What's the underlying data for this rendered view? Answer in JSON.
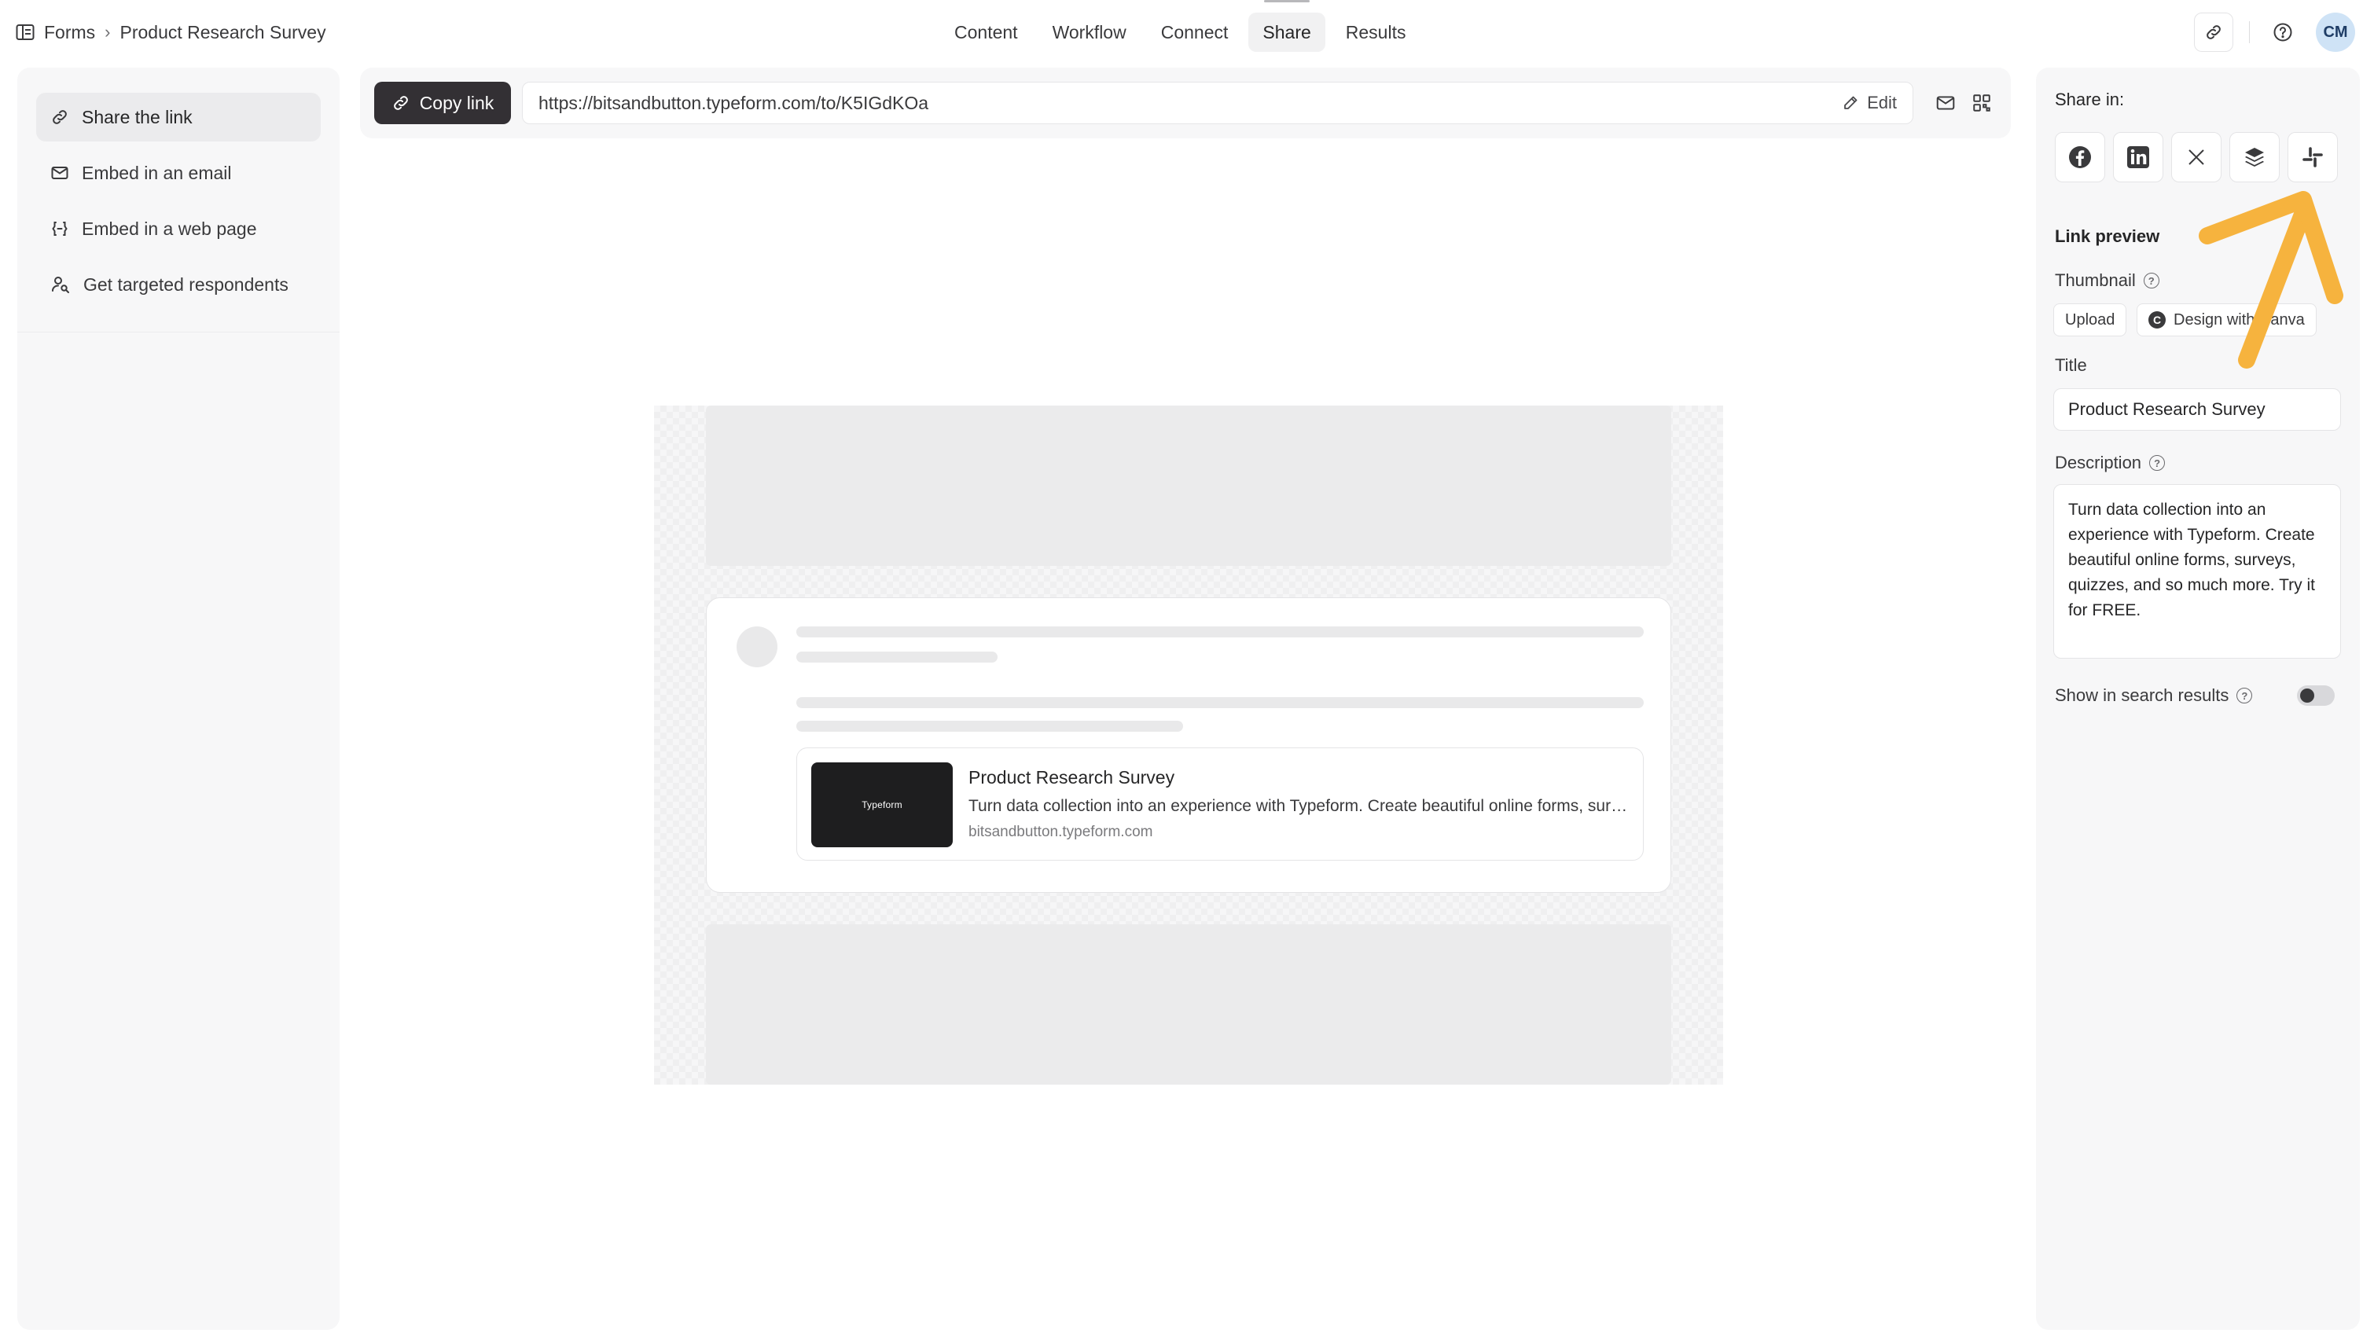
{
  "breadcrumb": {
    "root": "Forms",
    "current": "Product Research Survey"
  },
  "nav": {
    "tabs": [
      {
        "label": "Content"
      },
      {
        "label": "Workflow"
      },
      {
        "label": "Connect"
      },
      {
        "label": "Share",
        "active": true
      },
      {
        "label": "Results"
      }
    ]
  },
  "user": {
    "initials": "CM"
  },
  "sidebar": {
    "items": [
      {
        "label": "Share the link",
        "icon": "link-icon",
        "active": true
      },
      {
        "label": "Embed in an email",
        "icon": "mail-icon"
      },
      {
        "label": "Embed in a web page",
        "icon": "embed-code-icon"
      },
      {
        "label": "Get targeted respondents",
        "icon": "people-search-icon"
      }
    ]
  },
  "linkbar": {
    "copy_label": "Copy link",
    "url": "https://bitsandbutton.typeform.com/to/K5IGdKOa",
    "edit_label": "Edit"
  },
  "preview": {
    "thumb_brand": "Typeform",
    "title": "Product Research Survey",
    "description": "Turn data collection into an experience with Typeform. Create beautiful online forms, surveys, quizzes, and so much more. Try it for FREE.",
    "domain": "bitsandbutton.typeform.com"
  },
  "right_panel": {
    "share_in_label": "Share in:",
    "share_icons": [
      "facebook-icon",
      "linkedin-icon",
      "x-icon",
      "buffer-icon",
      "slack-icon"
    ],
    "link_preview_heading": "Link preview",
    "thumbnail_label": "Thumbnail",
    "upload_label": "Upload",
    "canva_label": "Design with Canva",
    "canva_glyph": "C",
    "title_label": "Title",
    "title_value": "Product Research Survey",
    "description_label": "Description",
    "description_value": "Turn data collection into an experience with Typeform. Create beautiful online forms, surveys, quizzes, and so much more. Try it for FREE.",
    "search_label": "Show in search results",
    "search_enabled": false
  },
  "colors": {
    "copy_button_bg": "#333034",
    "panel_bg": "#f7f7f8",
    "annotation_arrow": "#f6b33e",
    "avatar_bg": "#cfe3f6"
  }
}
